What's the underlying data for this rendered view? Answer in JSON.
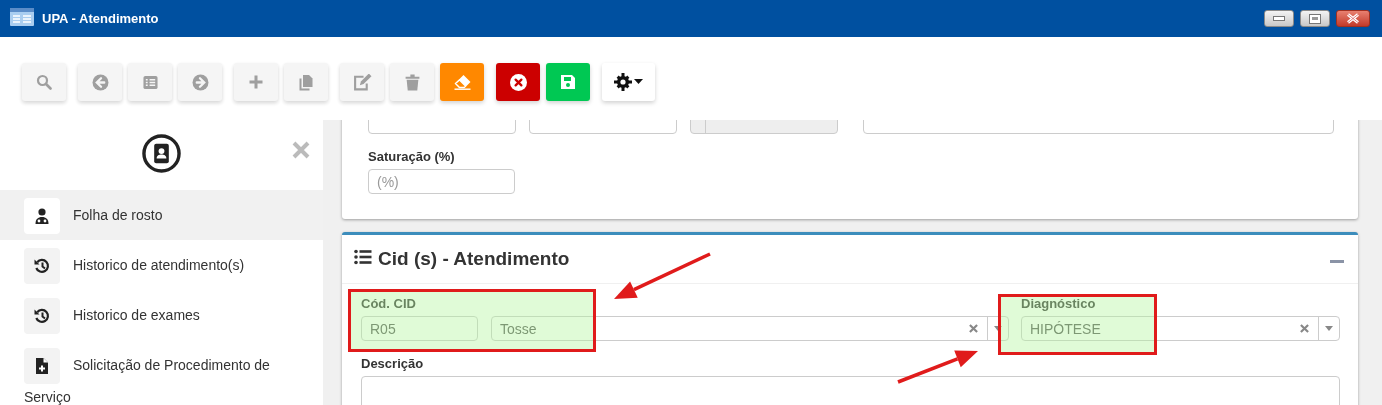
{
  "window": {
    "title": "UPA - Atendimento"
  },
  "toolbar": {
    "groups": [
      {
        "buttons": [
          {
            "kind": "search",
            "disabled": true,
            "color": "#f5f5f5"
          }
        ]
      },
      {
        "buttons": [
          {
            "kind": "back",
            "disabled": true,
            "color": "#f5f5f5"
          },
          {
            "kind": "list",
            "disabled": true,
            "color": "#f5f5f5"
          },
          {
            "kind": "forward",
            "disabled": true,
            "color": "#f5f5f5"
          }
        ]
      },
      {
        "buttons": [
          {
            "kind": "add",
            "disabled": true,
            "color": "#f5f5f5"
          },
          {
            "kind": "copy",
            "disabled": true,
            "color": "#f5f5f5"
          }
        ]
      },
      {
        "buttons": [
          {
            "kind": "edit",
            "disabled": true,
            "color": "#f5f5f5"
          },
          {
            "kind": "delete",
            "disabled": true,
            "color": "#f5f5f5"
          },
          {
            "kind": "eraser",
            "disabled": false,
            "color": "#ff8800"
          }
        ]
      },
      {
        "buttons": [
          {
            "kind": "cancel",
            "disabled": false,
            "color": "#cc0000"
          },
          {
            "kind": "save",
            "disabled": false,
            "color": "#00c853"
          }
        ]
      },
      {
        "buttons": [
          {
            "kind": "settings",
            "disabled": false,
            "color": "#ffffff"
          }
        ]
      }
    ]
  },
  "sidebar": {
    "items": [
      {
        "label": "Folha de rosto",
        "kind": "doctor",
        "selected": true
      },
      {
        "label": "Historico de atendimento(s)",
        "kind": "history",
        "selected": false
      },
      {
        "label": "Historico de exames",
        "kind": "history",
        "selected": false
      },
      {
        "label": "Solicitação de Procedimento de Serviço",
        "kind": "file-plus",
        "selected": false
      }
    ]
  },
  "vitals_card": {
    "fields": [
      {
        "kind": "text"
      },
      {
        "kind": "text"
      },
      {
        "kind": "addon"
      },
      {
        "kind": "wide"
      }
    ],
    "saturation": {
      "label": "Saturação (%)",
      "placeholder": "(%)"
    }
  },
  "cid_card": {
    "title": "Cid (s) - Atendimento",
    "cid": {
      "label": "Cód. CID",
      "code": "R05",
      "name": "Tosse",
      "highlighted": true
    },
    "diagnosis": {
      "label": "Diagnóstico",
      "value": "HIPÓTESE",
      "highlighted": true
    },
    "description": {
      "label": "Descrição"
    }
  }
}
